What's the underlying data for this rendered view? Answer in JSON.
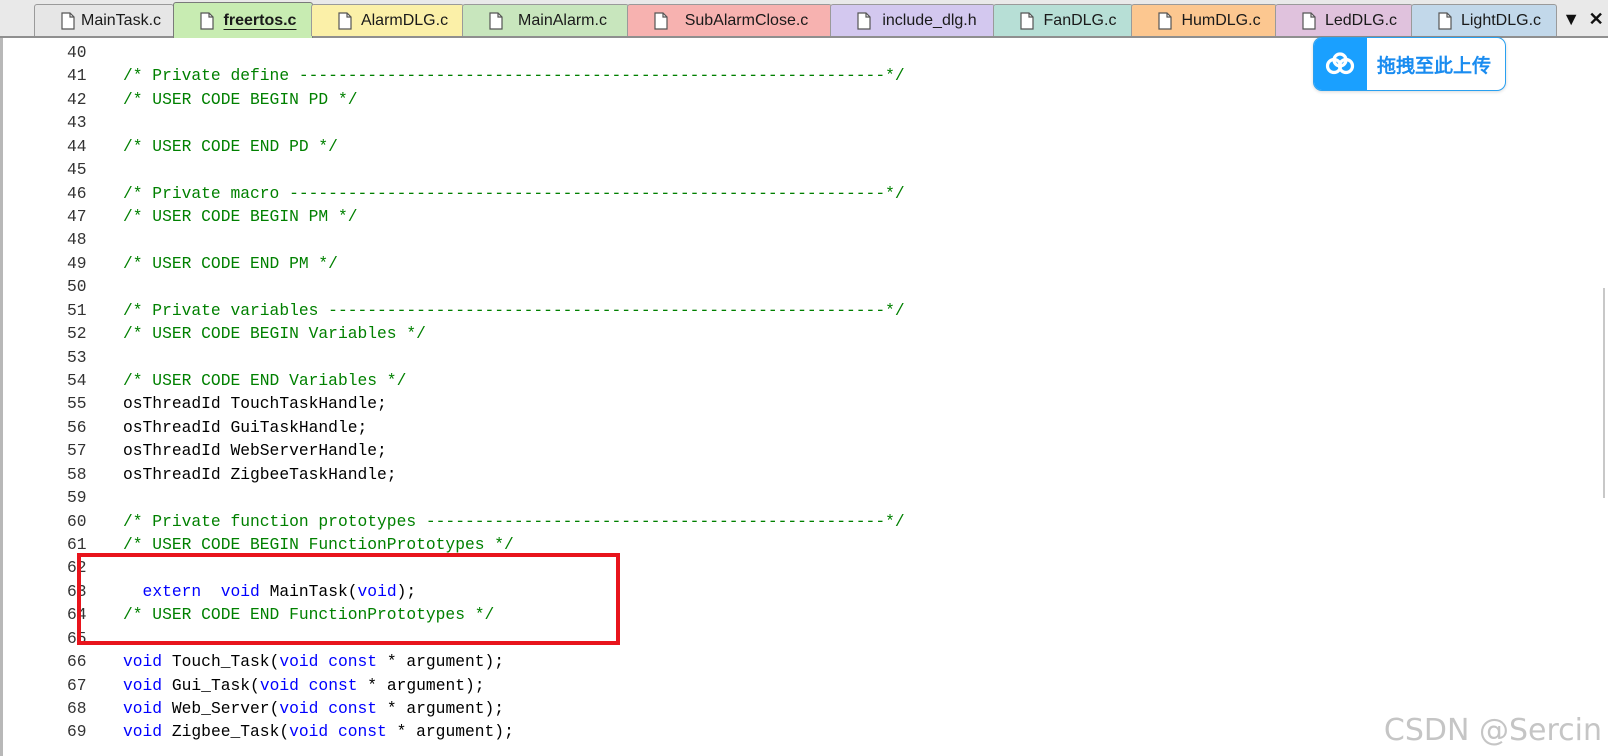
{
  "tabs": [
    {
      "label": "MainTask.c",
      "color": "#e6e6e6",
      "active": false
    },
    {
      "label": "freertos.c",
      "color": "#c8ecb2",
      "active": true
    },
    {
      "label": "AlarmDLG.c",
      "color": "#fbf0a8",
      "active": false
    },
    {
      "label": "MainAlarm.c",
      "color": "#c8e6bd",
      "active": false
    },
    {
      "label": "SubAlarmClose.c",
      "color": "#f7b2b0",
      "active": false
    },
    {
      "label": "include_dlg.h",
      "color": "#d3c8ef",
      "active": false
    },
    {
      "label": "FanDLG.c",
      "color": "#b7dfd6",
      "active": false
    },
    {
      "label": "HumDLG.c",
      "color": "#fcc790",
      "active": false
    },
    {
      "label": "LedDLG.c",
      "color": "#e0c2dd",
      "active": false
    },
    {
      "label": "LightDLG.c",
      "color": "#c2d8ea",
      "active": false
    }
  ],
  "tab_controls": {
    "menu_glyph": "▼",
    "close_glyph": "✕"
  },
  "editor": {
    "lines": [
      {
        "no": "40",
        "tokens": []
      },
      {
        "no": "41",
        "tokens": [
          {
            "t": "c",
            "s": "/* Private define ------------------------------------------------------------*/"
          }
        ]
      },
      {
        "no": "42",
        "tokens": [
          {
            "t": "c",
            "s": "/* USER CODE BEGIN PD */"
          }
        ]
      },
      {
        "no": "43",
        "tokens": []
      },
      {
        "no": "44",
        "tokens": [
          {
            "t": "c",
            "s": "/* USER CODE END PD */"
          }
        ]
      },
      {
        "no": "45",
        "tokens": []
      },
      {
        "no": "46",
        "tokens": [
          {
            "t": "c",
            "s": "/* Private macro -------------------------------------------------------------*/"
          }
        ]
      },
      {
        "no": "47",
        "tokens": [
          {
            "t": "c",
            "s": "/* USER CODE BEGIN PM */"
          }
        ]
      },
      {
        "no": "48",
        "tokens": []
      },
      {
        "no": "49",
        "tokens": [
          {
            "t": "c",
            "s": "/* USER CODE END PM */"
          }
        ]
      },
      {
        "no": "50",
        "tokens": []
      },
      {
        "no": "51",
        "tokens": [
          {
            "t": "c",
            "s": "/* Private variables ---------------------------------------------------------*/"
          }
        ]
      },
      {
        "no": "52",
        "tokens": [
          {
            "t": "c",
            "s": "/* USER CODE BEGIN Variables */"
          }
        ]
      },
      {
        "no": "53",
        "tokens": []
      },
      {
        "no": "54",
        "tokens": [
          {
            "t": "c",
            "s": "/* USER CODE END Variables */"
          }
        ]
      },
      {
        "no": "55",
        "tokens": [
          {
            "t": "n",
            "s": "osThreadId TouchTaskHandle;"
          }
        ]
      },
      {
        "no": "56",
        "tokens": [
          {
            "t": "n",
            "s": "osThreadId GuiTaskHandle;"
          }
        ]
      },
      {
        "no": "57",
        "tokens": [
          {
            "t": "n",
            "s": "osThreadId WebServerHandle;"
          }
        ]
      },
      {
        "no": "58",
        "tokens": [
          {
            "t": "n",
            "s": "osThreadId ZigbeeTaskHandle;"
          }
        ]
      },
      {
        "no": "59",
        "tokens": []
      },
      {
        "no": "60",
        "tokens": [
          {
            "t": "c",
            "s": "/* Private function prototypes -----------------------------------------------*/"
          }
        ]
      },
      {
        "no": "61",
        "tokens": [
          {
            "t": "c",
            "s": "/* USER CODE BEGIN FunctionPrototypes */"
          }
        ]
      },
      {
        "no": "62",
        "tokens": []
      },
      {
        "no": "63",
        "tokens": [
          {
            "t": "n",
            "s": "  "
          },
          {
            "t": "k",
            "s": "extern"
          },
          {
            "t": "n",
            "s": "  "
          },
          {
            "t": "k",
            "s": "void"
          },
          {
            "t": "n",
            "s": " MainTask("
          },
          {
            "t": "k",
            "s": "void"
          },
          {
            "t": "n",
            "s": ");"
          }
        ]
      },
      {
        "no": "64",
        "tokens": [
          {
            "t": "c",
            "s": "/* USER CODE END FunctionPrototypes */"
          }
        ]
      },
      {
        "no": "65",
        "tokens": []
      },
      {
        "no": "66",
        "tokens": [
          {
            "t": "k",
            "s": "void"
          },
          {
            "t": "n",
            "s": " Touch_Task("
          },
          {
            "t": "k",
            "s": "void const"
          },
          {
            "t": "n",
            "s": " * argument);"
          }
        ]
      },
      {
        "no": "67",
        "tokens": [
          {
            "t": "k",
            "s": "void"
          },
          {
            "t": "n",
            "s": " Gui_Task("
          },
          {
            "t": "k",
            "s": "void const"
          },
          {
            "t": "n",
            "s": " * argument);"
          }
        ]
      },
      {
        "no": "68",
        "tokens": [
          {
            "t": "k",
            "s": "void"
          },
          {
            "t": "n",
            "s": " Web_Server("
          },
          {
            "t": "k",
            "s": "void const"
          },
          {
            "t": "n",
            "s": " * argument);"
          }
        ]
      },
      {
        "no": "69",
        "tokens": [
          {
            "t": "k",
            "s": "void"
          },
          {
            "t": "n",
            "s": " Zigbee_Task("
          },
          {
            "t": "k",
            "s": "void const"
          },
          {
            "t": "n",
            "s": " * argument);"
          }
        ]
      }
    ]
  },
  "upload_badge": {
    "label": "拖拽至此上传",
    "icon": "cloud-icon",
    "color": "#1aa0ff"
  },
  "highlight": {
    "color": "#e8141c"
  },
  "watermark": "CSDN @Sercin",
  "colors": {
    "comment": "#008000",
    "keyword": "#0000ff",
    "text": "#000000"
  }
}
